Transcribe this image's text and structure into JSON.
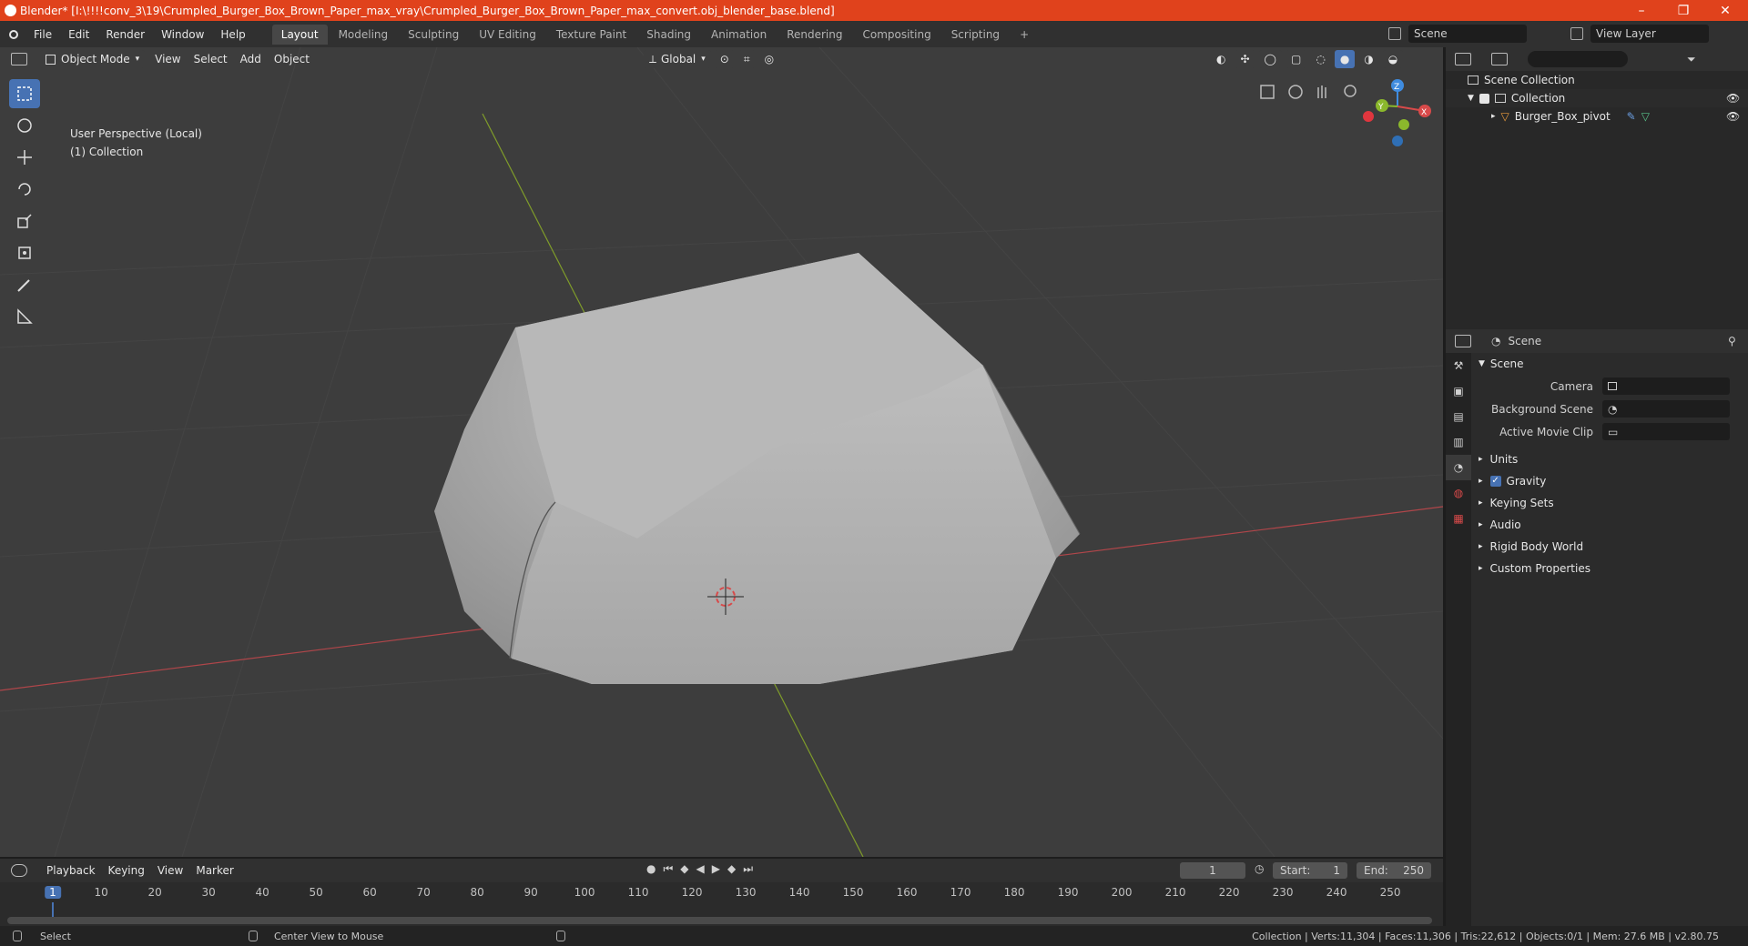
{
  "window": {
    "title": "Blender* [I:\\!!!!conv_3\\19\\Crumpled_Burger_Box_Brown_Paper_max_vray\\Crumpled_Burger_Box_Brown_Paper_max_convert.obj_blender_base.blend]",
    "minimize": "–",
    "maximize": "❐",
    "close": "✕"
  },
  "menu": {
    "items": [
      "File",
      "Edit",
      "Render",
      "Window",
      "Help"
    ],
    "workspaces": [
      "Layout",
      "Modeling",
      "Sculpting",
      "UV Editing",
      "Texture Paint",
      "Shading",
      "Animation",
      "Rendering",
      "Compositing",
      "Scripting"
    ],
    "active_workspace": "Layout",
    "add_tab": "+",
    "scene_name": "Scene",
    "view_layer": "View Layer"
  },
  "viewport_header": {
    "mode": "Object Mode",
    "menus": [
      "View",
      "Select",
      "Add",
      "Object"
    ],
    "transform_orientation": "Global"
  },
  "viewport": {
    "perspective_label": "User Perspective (Local)",
    "collection_label": "(1) Collection",
    "gizmo_axes": {
      "x": "X",
      "y": "Y",
      "z": "Z"
    }
  },
  "outliner": {
    "scene_collection": "Scene Collection",
    "collection": "Collection",
    "object": "Burger_Box_pivot"
  },
  "properties": {
    "header_title": "Scene",
    "panel_title": "Scene",
    "rows": [
      {
        "label": "Camera",
        "value": ""
      },
      {
        "label": "Background Scene",
        "value": ""
      },
      {
        "label": "Active Movie Clip",
        "value": ""
      }
    ],
    "subpanels": [
      "Units",
      "Gravity",
      "Keying Sets",
      "Audio",
      "Rigid Body World",
      "Custom Properties"
    ]
  },
  "timeline": {
    "menus": [
      "Playback",
      "Keying",
      "View",
      "Marker"
    ],
    "current_frame": "1",
    "start_label": "Start:",
    "start": "1",
    "end_label": "End:",
    "end": "250",
    "ruler": [
      "1",
      "10",
      "20",
      "30",
      "40",
      "50",
      "60",
      "70",
      "80",
      "90",
      "100",
      "110",
      "120",
      "130",
      "140",
      "150",
      "160",
      "170",
      "180",
      "190",
      "200",
      "210",
      "220",
      "230",
      "240",
      "250"
    ]
  },
  "statusbar": {
    "select": "Select",
    "center_view": "Center View to Mouse",
    "stats": "Collection | Verts:11,304 | Faces:11,306 | Tris:22,612 | Objects:0/1 | Mem: 27.6 MB | v2.80.75"
  },
  "colors": {
    "titlebar": "#e0421c",
    "accent": "#4772b3",
    "x_axis": "#d84a4a",
    "y_axis": "#8bb82c",
    "z_axis": "#3f8ce0"
  }
}
